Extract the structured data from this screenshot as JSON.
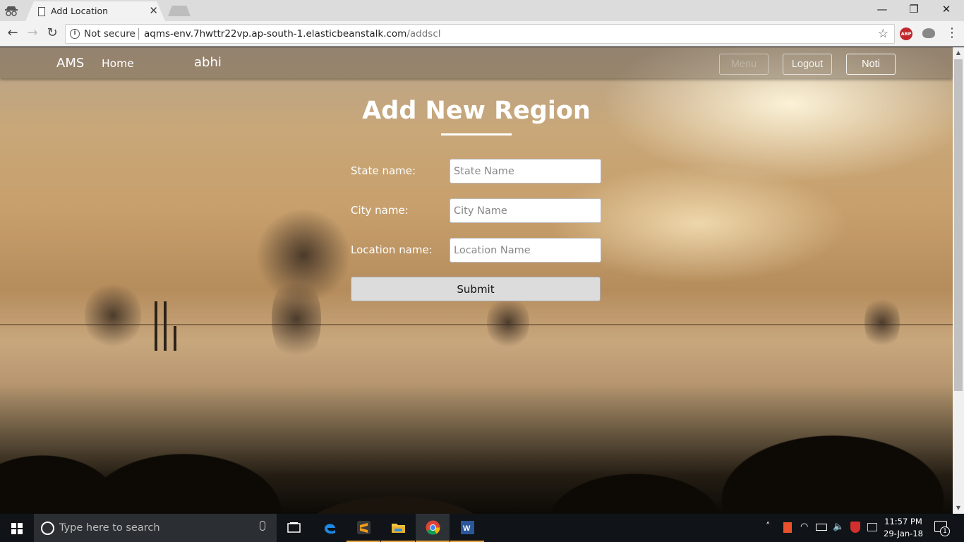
{
  "browser": {
    "tab_title": "Add Location",
    "tab_close": "✕",
    "security_label": "Not secure",
    "url_host": "aqms-env.7hwttr22vp.ap-south-1.elasticbeanstalk.com",
    "url_path": "/addscl",
    "window_controls": {
      "minimize": "—",
      "restore": "❐",
      "close": "✕"
    },
    "nav": {
      "back": "←",
      "forward": "→",
      "reload": "↻"
    },
    "bookmark_star": "☆",
    "extension_abp": "ABP",
    "menu_glyph": "⋮"
  },
  "navbar": {
    "brand": "AMS",
    "home": "Home",
    "user": "abhi",
    "menu": "Menu",
    "logout": "Logout",
    "noti": "Noti"
  },
  "form": {
    "title": "Add New Region",
    "state_label": "State name:",
    "state_placeholder": "State Name",
    "city_label": "City name:",
    "city_placeholder": "City Name",
    "location_label": "Location name:",
    "location_placeholder": "Location Name",
    "submit": "Submit"
  },
  "taskbar": {
    "search_placeholder": "Type here to search",
    "clock_time": "11:57 PM",
    "clock_date": "29-Jan-18",
    "notification_count": "1",
    "apps": [
      "task-view",
      "edge",
      "sublime-text",
      "file-explorer",
      "chrome",
      "word"
    ]
  },
  "colors": {
    "accent_taskbar_active": "#76b9ed",
    "abp_red": "#c1272d",
    "office_orange": "#e8512b"
  }
}
